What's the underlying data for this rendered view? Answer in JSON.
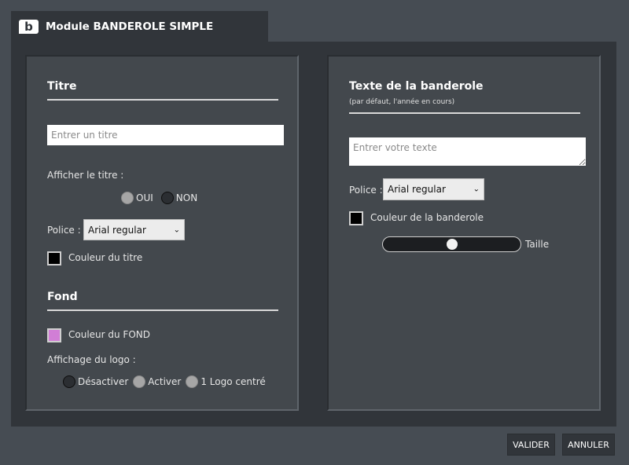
{
  "tab": {
    "logo": "b",
    "title": "Module BANDEROLE SIMPLE"
  },
  "left": {
    "titre_heading": "Titre",
    "title_input_placeholder": "Entrer un titre",
    "show_title_label": "Afficher le titre :",
    "show_title_options": [
      "OUI",
      "NON"
    ],
    "font_label": "Police :",
    "font_value": "Arial regular",
    "title_color_label": "Couleur du titre",
    "title_color": "#000000",
    "fond_heading": "Fond",
    "bg_color_label": "Couleur du FOND",
    "bg_color": "#d17ed6",
    "logo_display_label": "Affichage du logo :",
    "logo_options": [
      "Désactiver",
      "Activer",
      "1 Logo centré"
    ]
  },
  "right": {
    "heading": "Texte de la banderole",
    "subheading": "(par défaut, l'année en cours)",
    "text_placeholder": "Entrer votre texte",
    "font_label": "Police :",
    "font_value": "Arial regular",
    "banner_color_label": "Couleur de la banderole",
    "banner_color": "#000000",
    "size_label": "Taille",
    "size_value": 0.5
  },
  "buttons": {
    "validate": "VALIDER",
    "cancel": "ANNULER"
  }
}
